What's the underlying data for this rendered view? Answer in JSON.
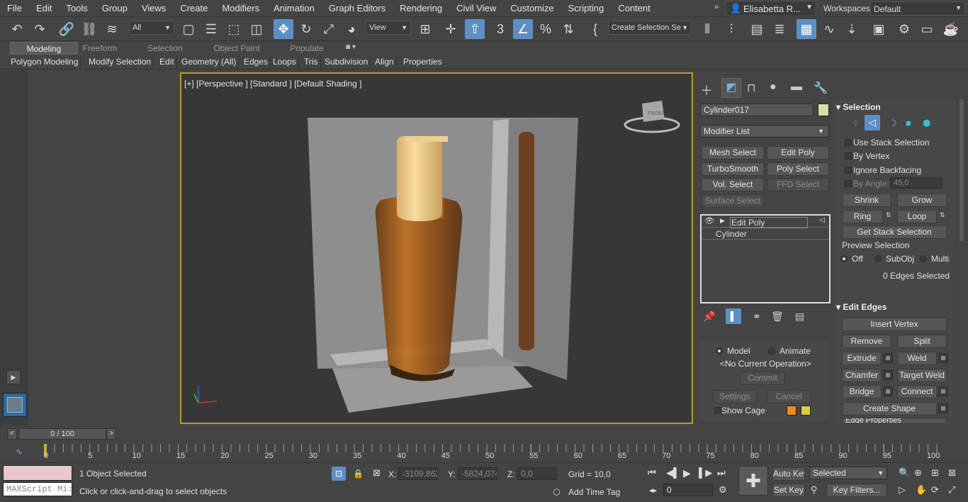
{
  "menubar": {
    "items": [
      "File",
      "Edit",
      "Tools",
      "Group",
      "Views",
      "Create",
      "Modifiers",
      "Animation",
      "Graph Editors",
      "Rendering",
      "Civil View",
      "Customize",
      "Scripting",
      "Content"
    ],
    "user": "Elisabetta R...",
    "workspaces_label": "Workspaces:",
    "workspace_value": "Default"
  },
  "toolbar": {
    "selection_filter": "All",
    "ref_coord": "View",
    "selection_set": "Create Selection Se"
  },
  "ribbon": {
    "tabs": [
      "Modeling",
      "Freeform",
      "Selection",
      "Object Paint",
      "Populate"
    ],
    "sub_items": [
      "Polygon Modeling",
      "Modify Selection",
      "Edit",
      "Geometry (All)",
      "Edges",
      "Loops",
      "Tris",
      "Subdivision",
      "Align",
      "Properties"
    ]
  },
  "viewport": {
    "label": "[+] [Perspective ] [Standard ] [Default Shading ]",
    "viewcube_face": "FRONT"
  },
  "command_panel": {
    "object_name": "Cylinder017",
    "object_color": "#d8e0a8",
    "modifier_list": "Modifier List",
    "modifier_buttons": [
      "Mesh Select",
      "Edit Poly",
      "TurboSmooth",
      "Poly Select",
      "Vol. Select",
      "FFD Select",
      "Surface Select"
    ],
    "stack": [
      "Edit Poly",
      "Cylinder"
    ],
    "operation": {
      "model": "Model",
      "animate": "Animate",
      "current": "<No Current Operation>",
      "commit": "Commit",
      "settings": "Settings",
      "cancel": "Cancel",
      "show_cage": "Show Cage",
      "cage_color1": "#f08a1c",
      "cage_color2": "#d8d040"
    },
    "selection": {
      "title": "Selection",
      "use_stack": "Use Stack Selection",
      "by_vertex": "By Vertex",
      "ignore_backfacing": "Ignore Backfacing",
      "by_angle": "By Angle:",
      "angle_value": "45,0",
      "shrink": "Shrink",
      "grow": "Grow",
      "ring": "Ring",
      "loop": "Loop",
      "get_stack": "Get Stack Selection",
      "preview": "Preview Selection",
      "off": "Off",
      "subobj": "SubObj",
      "multi": "Multi",
      "status": "0 Edges Selected"
    },
    "edit_edges": {
      "title": "Edit Edges",
      "insert_vertex": "Insert Vertex",
      "remove": "Remove",
      "split": "Split",
      "extrude": "Extrude",
      "weld": "Weld",
      "chamfer": "Chamfer",
      "target_weld": "Target Weld",
      "bridge": "Bridge",
      "connect": "Connect",
      "create_shape": "Create Shape",
      "edge_properties": "Edge Properties"
    }
  },
  "timeline": {
    "frame": "0 / 100",
    "ticks": [
      "0",
      "5",
      "10",
      "15",
      "20",
      "25",
      "30",
      "35",
      "40",
      "45",
      "50",
      "55",
      "60",
      "65",
      "70",
      "75",
      "80",
      "85",
      "90",
      "95",
      "100"
    ]
  },
  "status": {
    "maxscript": "MAXScript Mi:",
    "selected": "1 Object Selected",
    "hint": "Click or click-and-drag to select objects",
    "x_label": "X:",
    "x_value": "-3109,862",
    "y_label": "Y:",
    "y_value": "-5824,074",
    "z_label": "Z:",
    "z_value": "0,0",
    "grid": "Grid = 10,0",
    "add_time_tag": "Add Time Tag",
    "auto_key": "Auto Key",
    "set_key": "Set Key",
    "key_mode": "Selected",
    "key_filters": "Key Filters...",
    "frame_field": "0"
  }
}
